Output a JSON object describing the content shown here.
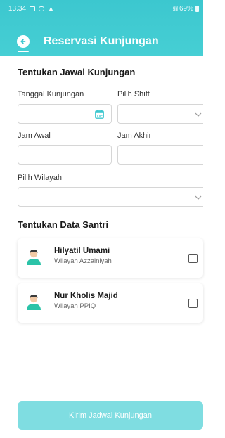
{
  "status_bar": {
    "time": "13.34",
    "battery": "69%"
  },
  "header": {
    "title": "Reservasi Kunjungan"
  },
  "schedule_section": {
    "title": "Tentukan Jawal Kunjungan",
    "tanggal_label": "Tanggal Kunjungan",
    "tanggal_value": "",
    "shift_label": "Pilih Shift",
    "shift_value": "",
    "jam_awal_label": "Jam Awal",
    "jam_awal_value": "",
    "jam_akhir_label": "Jam Akhir",
    "jam_akhir_value": "",
    "wilayah_label": "Pilih Wilayah",
    "wilayah_value": ""
  },
  "santri_section": {
    "title": "Tentukan Data Santri",
    "items": [
      {
        "name": "Hilyatil Umami",
        "wilayah": "Wilayah Azzainiyah",
        "checked": false
      },
      {
        "name": "Nur Kholis Majid",
        "wilayah": "Wilayah PPIQ",
        "checked": false
      }
    ]
  },
  "submit_button": {
    "label": "Kirim Jadwal Kunjungan"
  },
  "colors": {
    "primary": "#3cc7cf",
    "button_disabled": "#7fdde1",
    "avatar_shirt": "#2bc3a8"
  }
}
